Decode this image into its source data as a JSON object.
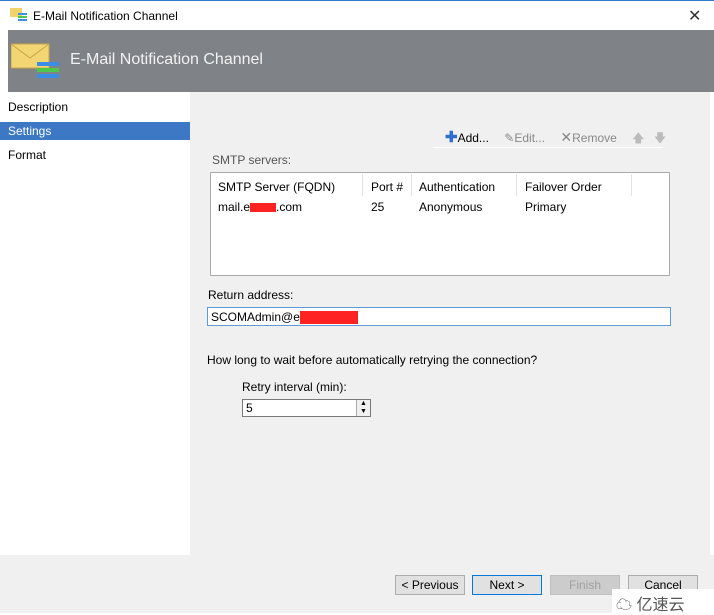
{
  "window": {
    "title": "E-Mail Notification Channel",
    "close": "✕"
  },
  "header": {
    "title": "E-Mail Notification Channel",
    "icon": "envelope-arrows-icon"
  },
  "nav": {
    "items": [
      {
        "label": "Description"
      },
      {
        "label": "Settings",
        "selected": true
      },
      {
        "label": "Format"
      }
    ]
  },
  "toolbar": {
    "add": "Add...",
    "edit": "Edit...",
    "remove": "Remove",
    "up": "🡅",
    "down": "🡇"
  },
  "smtp": {
    "label": "SMTP servers:",
    "columns": [
      "SMTP Server (FQDN)",
      "Port #",
      "Authentication",
      "Failover Order"
    ],
    "rows": [
      {
        "server_prefix": "mail.e",
        "server_suffix": ".com",
        "port": "25",
        "auth": "Anonymous",
        "order": "Primary"
      }
    ]
  },
  "return_address": {
    "label": "Return address:",
    "value": "SCOMAdmin@e"
  },
  "retry": {
    "question": "How long to wait before automatically retrying the connection?",
    "label": "Retry interval (min):",
    "value": "5"
  },
  "buttons": {
    "previous": "< Previous",
    "next": "Next >",
    "finish": "Finish",
    "cancel": "Cancel"
  },
  "watermark": "亿速云",
  "colors": {
    "selection": "#3c78c4",
    "header": "#7f8287",
    "redaction": "#ff2222"
  }
}
